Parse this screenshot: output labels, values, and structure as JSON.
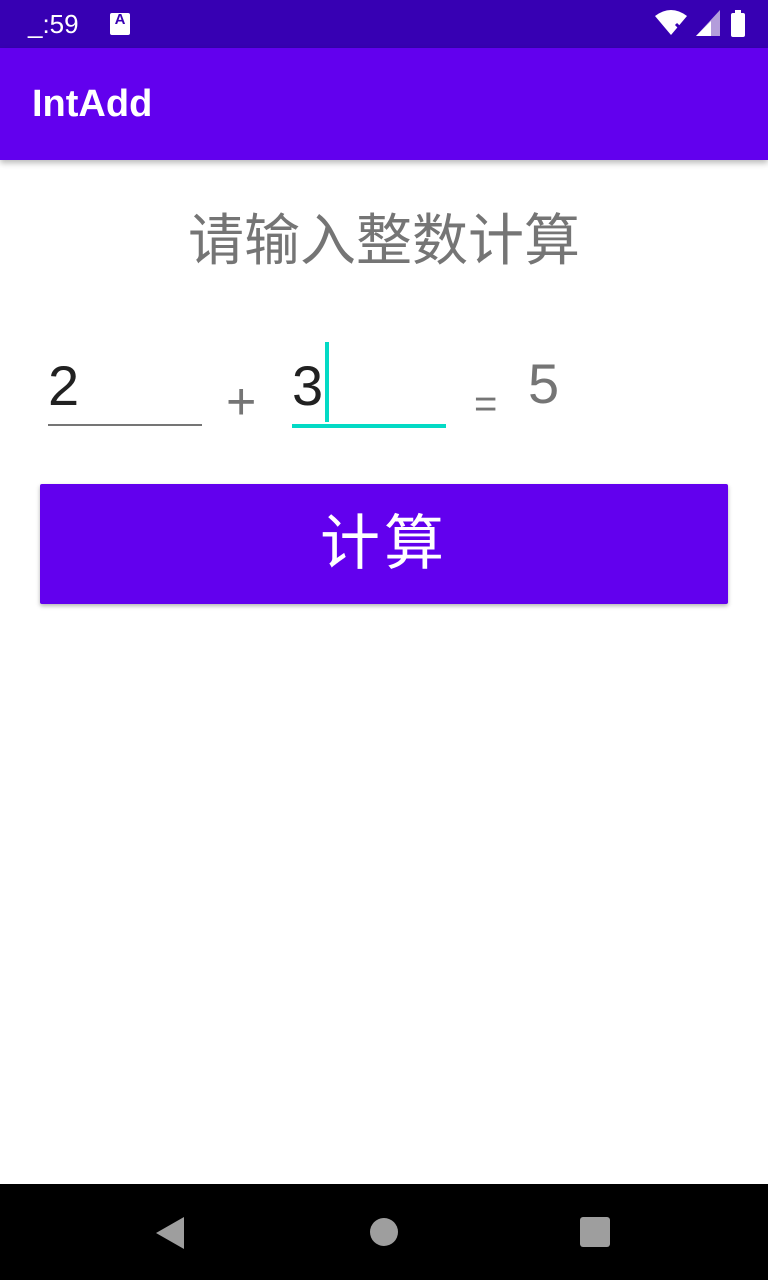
{
  "status_bar": {
    "time": "_:59",
    "icons": [
      "notification-a-icon",
      "wifi-icon",
      "cell-signal-icon",
      "battery-icon"
    ]
  },
  "app_bar": {
    "title": "IntAdd"
  },
  "main": {
    "prompt": "请输入整数计算",
    "first_operand": "2",
    "plus_symbol": "+",
    "second_operand": "3",
    "equals_symbol": "=",
    "result": "5",
    "calculate_button": "计算"
  },
  "colors": {
    "status_bar": "#3700B3",
    "primary": "#6200EE",
    "accent": "#03DAC5",
    "secondary_text": "#757575"
  },
  "nav_bar": {
    "icons": [
      "back-icon",
      "home-icon",
      "recents-icon"
    ]
  }
}
